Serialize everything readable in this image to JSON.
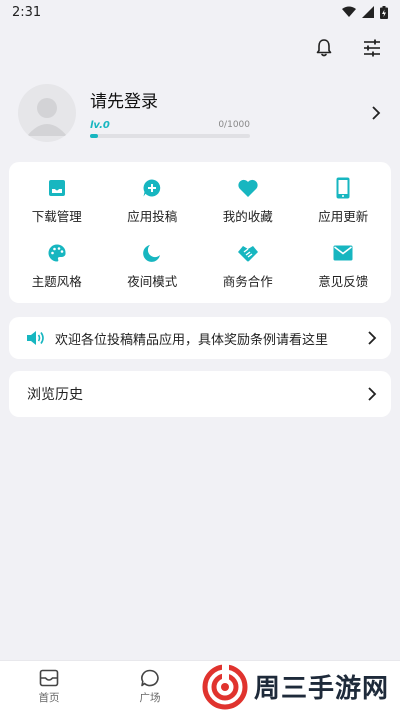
{
  "status_bar": {
    "time": "2:31"
  },
  "profile": {
    "login_prompt": "请先登录",
    "level_label": "lv.0",
    "level_progress_text": "0/1000",
    "level_fraction": 0.05
  },
  "features": [
    {
      "label": "下载管理",
      "icon": "inbox-icon"
    },
    {
      "label": "应用投稿",
      "icon": "chat-plus-icon"
    },
    {
      "label": "我的收藏",
      "icon": "heart-icon"
    },
    {
      "label": "应用更新",
      "icon": "phone-icon"
    },
    {
      "label": "主题风格",
      "icon": "palette-icon"
    },
    {
      "label": "夜间模式",
      "icon": "moon-icon"
    },
    {
      "label": "商务合作",
      "icon": "handshake-icon"
    },
    {
      "label": "意见反馈",
      "icon": "mail-icon"
    }
  ],
  "notice": {
    "text": "欢迎各位投稿精品应用，具体奖励条例请看这里"
  },
  "history": {
    "label": "浏览历史"
  },
  "bottom_nav": [
    {
      "label": "首页",
      "icon": "home-inbox-icon"
    },
    {
      "label": "广场",
      "icon": "chat-bubble-icon"
    }
  ],
  "watermark": {
    "text": "周三手游网"
  },
  "colors": {
    "accent": "#17b6c0",
    "background": "#f1f1f5",
    "card": "#ffffff"
  }
}
